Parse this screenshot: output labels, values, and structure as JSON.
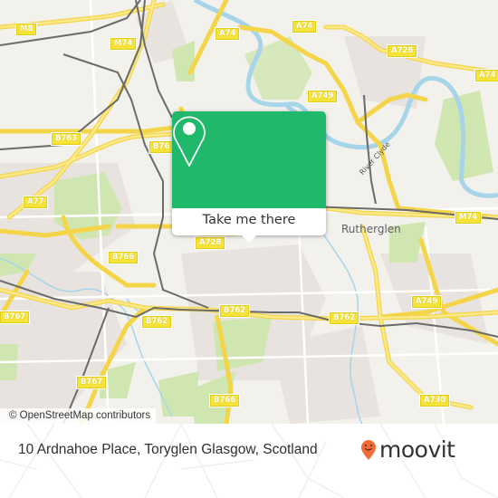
{
  "map": {
    "place_labels": [
      {
        "id": "rutherglen",
        "text": "Rutherglen"
      }
    ],
    "river_label": "River Clyde",
    "road_shields": [
      {
        "id": "m8",
        "text": "M8"
      },
      {
        "id": "m74-nw",
        "text": "M74"
      },
      {
        "id": "a74-n",
        "text": "A74"
      },
      {
        "id": "a74-ne",
        "text": "A74"
      },
      {
        "id": "a728-ne",
        "text": "A728"
      },
      {
        "id": "a74-e",
        "text": "A74"
      },
      {
        "id": "a749-n",
        "text": "A749"
      },
      {
        "id": "b763",
        "text": "B763"
      },
      {
        "id": "b76x",
        "text": "B76"
      },
      {
        "id": "a77",
        "text": "A77"
      },
      {
        "id": "a728-c",
        "text": "A728"
      },
      {
        "id": "m74-e",
        "text": "M74"
      },
      {
        "id": "b766-w",
        "text": "B766"
      },
      {
        "id": "b767-w",
        "text": "B767"
      },
      {
        "id": "b762-w",
        "text": "B762"
      },
      {
        "id": "b762-c",
        "text": "B762"
      },
      {
        "id": "b762-e",
        "text": "B762"
      },
      {
        "id": "a749-e",
        "text": "A749"
      },
      {
        "id": "b767-s",
        "text": "B767"
      },
      {
        "id": "b766-s",
        "text": "B766"
      },
      {
        "id": "a730",
        "text": "A730"
      }
    ],
    "colors": {
      "background": "#f2f1ec",
      "park": "#cfe6b0",
      "urban": "#e8e2de",
      "road": "#f7e36a",
      "river": "#a6d5ea",
      "rail": "#6b6b6b"
    }
  },
  "popup": {
    "icon": "location-pin-icon",
    "button_label": "Take me there",
    "color": "#20b86a"
  },
  "attribution": "© OpenStreetMap contributors",
  "footer": {
    "address": "10 Ardnahoe Place, Toryglen Glasgow, Scotland",
    "brand": "moovit",
    "brand_icon": "moovit-pin-smile-icon",
    "brand_color": "#f26a35"
  }
}
